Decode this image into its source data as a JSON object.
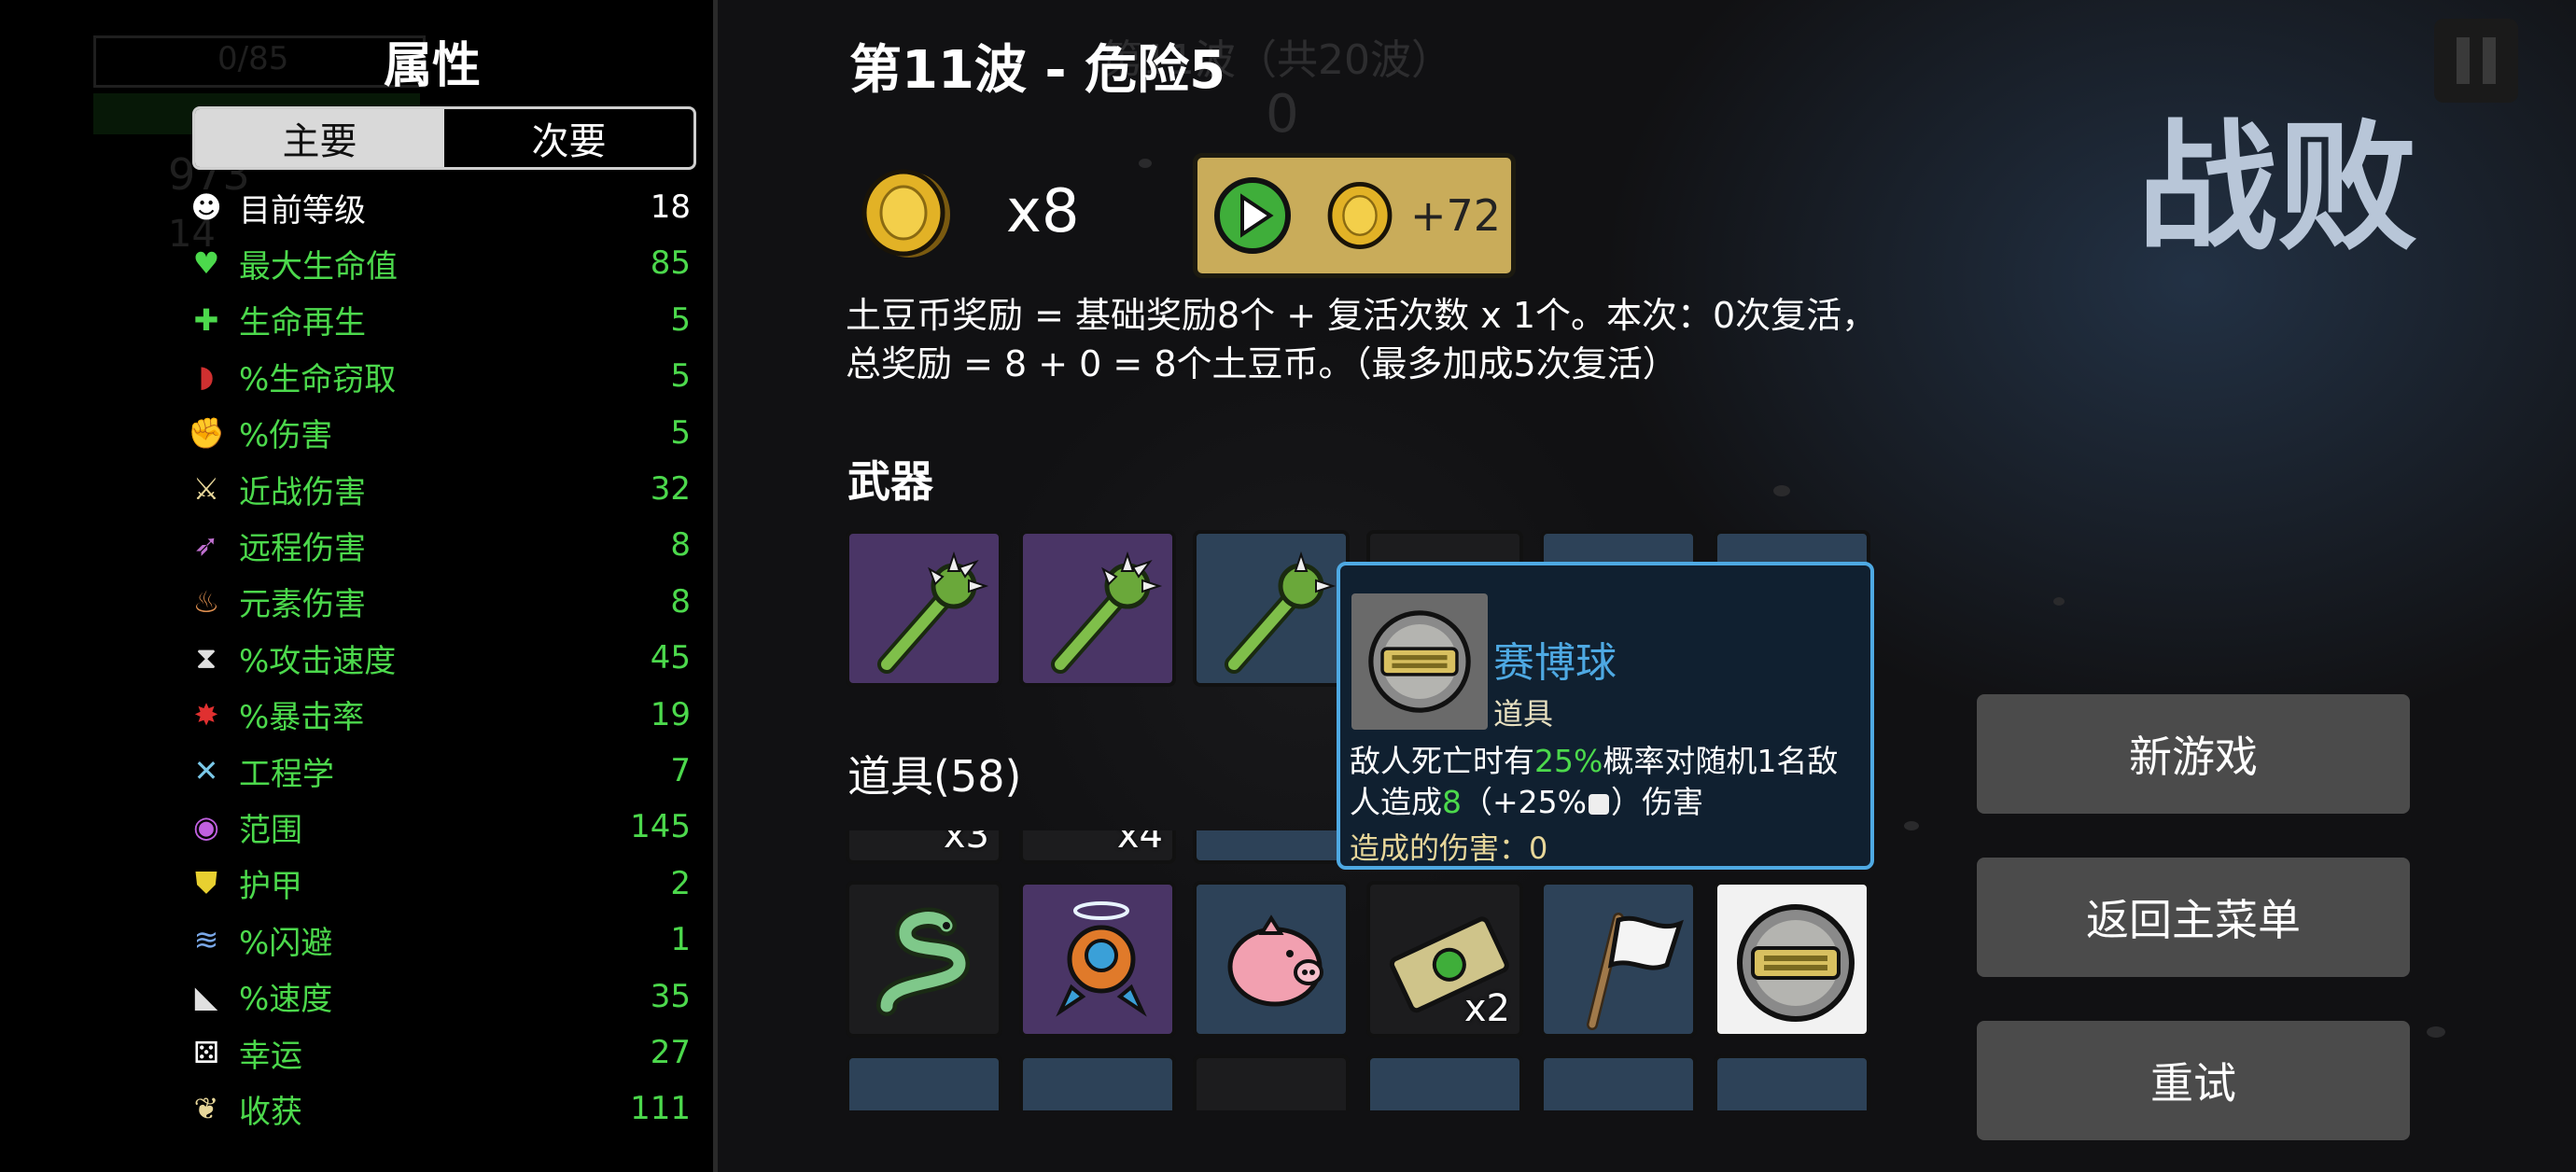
{
  "stats_panel": {
    "title": "属性",
    "tabs": [
      {
        "label": "主要",
        "active": true
      },
      {
        "label": "次要",
        "active": false
      }
    ],
    "stats": [
      {
        "icon": "level-icon",
        "label": "目前等级",
        "value": "18",
        "color": "white"
      },
      {
        "icon": "heart-icon",
        "label": "最大生命值",
        "value": "85",
        "color": "green"
      },
      {
        "icon": "regen-icon",
        "label": "生命再生",
        "value": "5",
        "color": "green"
      },
      {
        "icon": "lifesteal-icon",
        "label": "%生命窃取",
        "value": "5",
        "color": "green"
      },
      {
        "icon": "damage-icon",
        "label": "%伤害",
        "value": "5",
        "color": "green"
      },
      {
        "icon": "sword-icon",
        "label": "近战伤害",
        "value": "32",
        "color": "green"
      },
      {
        "icon": "bow-icon",
        "label": "远程伤害",
        "value": "8",
        "color": "green"
      },
      {
        "icon": "flame-icon",
        "label": "元素伤害",
        "value": "8",
        "color": "green"
      },
      {
        "icon": "hourglass-icon",
        "label": "%攻击速度",
        "value": "45",
        "color": "green"
      },
      {
        "icon": "crit-icon",
        "label": "%暴击率",
        "value": "19",
        "color": "green"
      },
      {
        "icon": "wrench-icon",
        "label": "工程学",
        "value": "7",
        "color": "green"
      },
      {
        "icon": "range-icon",
        "label": "范围",
        "value": "145",
        "color": "green"
      },
      {
        "icon": "shield-icon",
        "label": "护甲",
        "value": "2",
        "color": "green"
      },
      {
        "icon": "dodge-icon",
        "label": "%闪避",
        "value": "1",
        "color": "green"
      },
      {
        "icon": "boot-icon",
        "label": "%速度",
        "value": "35",
        "color": "green"
      },
      {
        "icon": "dice-icon",
        "label": "幸运",
        "value": "27",
        "color": "green"
      },
      {
        "icon": "harvest-icon",
        "label": "收获",
        "value": "111",
        "color": "green"
      }
    ]
  },
  "background_hud": {
    "hp_text": "0/85",
    "materials": "973",
    "bag": "14",
    "wave_bg": "第11波（共20波）",
    "timer": "0"
  },
  "main": {
    "wave_title": "第11波 - 危险5",
    "coin_multiplier": "x8",
    "ad_reward": "+72",
    "reward_description": "土豆币奖励 = 基础奖励8个 + 复活次数 x 1个。本次：0次复活，总奖励 = 8 + 0 = 8个土豆币。（最多加成5次复活）",
    "weapons_title": "武器",
    "items_title": "道具(58)",
    "weapons": [
      {
        "icon": "spiked-club-icon",
        "tier": "purple"
      },
      {
        "icon": "spiked-club-icon",
        "tier": "purple"
      },
      {
        "icon": "spiked-club-icon",
        "tier": "blue"
      },
      {
        "icon": "weapon-icon",
        "tier": "black"
      },
      {
        "icon": "weapon-icon",
        "tier": "blue"
      },
      {
        "icon": "weapon-icon",
        "tier": "blue"
      }
    ],
    "items_partial_row": [
      {
        "qty": "x3"
      },
      {
        "qty": "x4"
      },
      {
        "qty": ""
      }
    ],
    "items": [
      {
        "icon": "snake-icon",
        "tier": "black",
        "qty": ""
      },
      {
        "icon": "alien-ship-icon",
        "tier": "purple",
        "qty": ""
      },
      {
        "icon": "piggy-bank-icon",
        "tier": "blue",
        "qty": ""
      },
      {
        "icon": "money-icon",
        "tier": "black",
        "qty": "x2"
      },
      {
        "icon": "white-flag-icon",
        "tier": "blue",
        "qty": ""
      },
      {
        "icon": "cyberball-icon",
        "tier": "white",
        "qty": ""
      }
    ]
  },
  "tooltip": {
    "name": "赛博球",
    "type": "道具",
    "desc_1": "敌人死亡时有",
    "desc_chance": "25%",
    "desc_2": "概率对随机1名敌",
    "desc_3": "人造成",
    "desc_dmg": "8",
    "desc_4": "（+25%",
    "desc_5": "）伤害",
    "damage_dealt": "造成的伤害：0"
  },
  "defeat_title": "战败",
  "menu": {
    "new_game": "新游戏",
    "main_menu": "返回主菜单",
    "retry": "重试"
  },
  "colors": {
    "stat_green": "#4cd94c",
    "tooltip_border": "#4ea9e3",
    "ad_button": "#c9ac5a",
    "menu_button": "#4b4b4b"
  }
}
